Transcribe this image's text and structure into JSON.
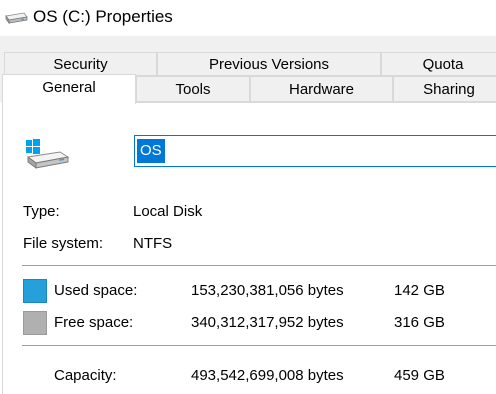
{
  "window": {
    "title": "OS (C:) Properties",
    "icon": "drive-icon"
  },
  "tabs": {
    "row1": [
      {
        "label": "Security"
      },
      {
        "label": "Previous Versions"
      },
      {
        "label": "Quota"
      }
    ],
    "row2": [
      {
        "label": "General",
        "active": true
      },
      {
        "label": "Tools"
      },
      {
        "label": "Hardware"
      },
      {
        "label": "Sharing"
      }
    ]
  },
  "general": {
    "drive_name": "OS",
    "type_label": "Type:",
    "type_value": "Local Disk",
    "fs_label": "File system:",
    "fs_value": "NTFS",
    "used_label": "Used space:",
    "used_bytes": "153,230,381,056 bytes",
    "used_gb": "142 GB",
    "free_label": "Free space:",
    "free_bytes": "340,312,317,952 bytes",
    "free_gb": "316 GB",
    "capacity_label": "Capacity:",
    "capacity_bytes": "493,542,699,008 bytes",
    "capacity_gb": "459 GB"
  },
  "colors": {
    "used": "#26a0da",
    "free": "#b0b0b0",
    "selection": "#0078d7"
  }
}
